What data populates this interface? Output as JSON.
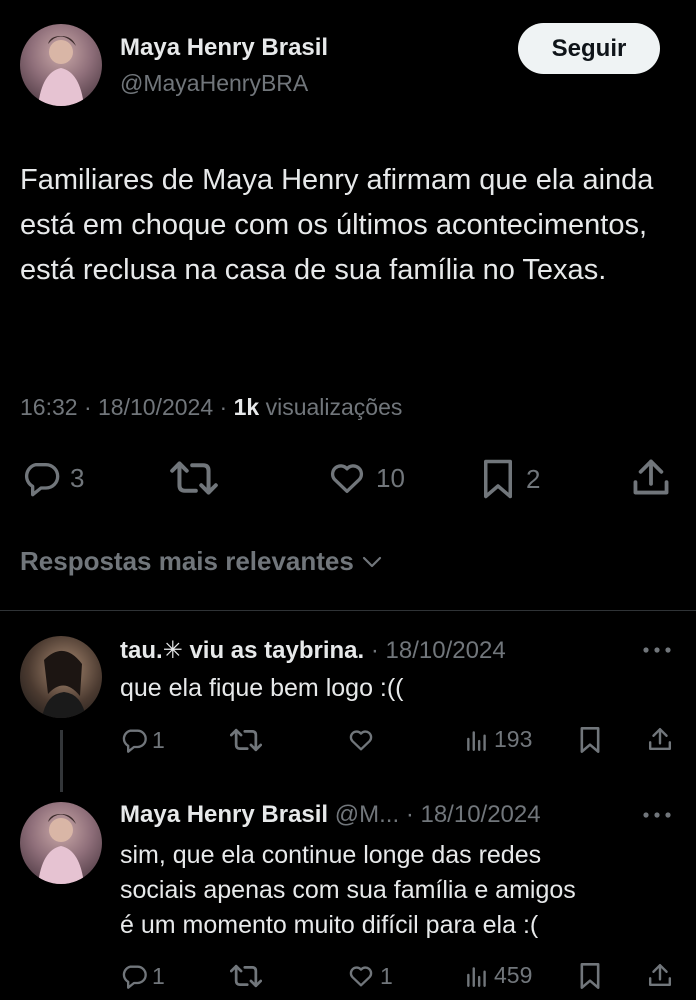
{
  "post": {
    "author_name": "Maya Henry Brasil",
    "author_handle": "@MayaHenryBRA",
    "follow_label": "Seguir",
    "text": "Familiares de Maya Henry afirmam que ela ainda está em choque com os últimos acontecimentos, está reclusa na casa de sua família no Texas.",
    "time": "16:32",
    "date": "18/10/2024",
    "views_count": "1k",
    "views_label": "visualizações",
    "replies": "3",
    "likes": "10",
    "bookmarks": "2"
  },
  "sort": {
    "label": "Respostas mais relevantes"
  },
  "replies": [
    {
      "name": "tau.",
      "name_suffix": "viu as taybrina.",
      "date": "18/10/2024",
      "text": "que ela fique bem logo :((",
      "reply_count": "1",
      "views": "193"
    },
    {
      "name": "Maya Henry Brasil",
      "handle": "@M...",
      "date": "18/10/2024",
      "text_lines": [
        "sim, que ela continue longe das redes",
        "sociais apenas com sua família e amigos",
        "é um momento muito difícil para ela :("
      ],
      "reply_count": "1",
      "like_count": "1",
      "views": "459"
    }
  ]
}
